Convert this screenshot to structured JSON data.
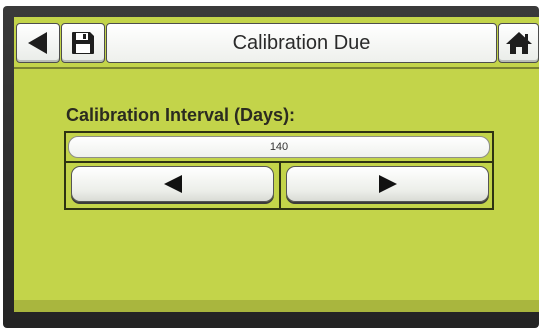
{
  "header": {
    "title": "Calibration Due",
    "back_icon": "back-arrow-icon",
    "save_icon": "floppy-disk-icon",
    "home_icon": "home-icon"
  },
  "content": {
    "interval_label": "Calibration Interval (Days):",
    "interval_value": "140",
    "decrease_icon": "left-arrow-icon",
    "increase_icon": "right-arrow-icon"
  },
  "colors": {
    "screen_background": "#c3d44a",
    "button_face": "#ffffff",
    "outline": "#2e3312"
  }
}
